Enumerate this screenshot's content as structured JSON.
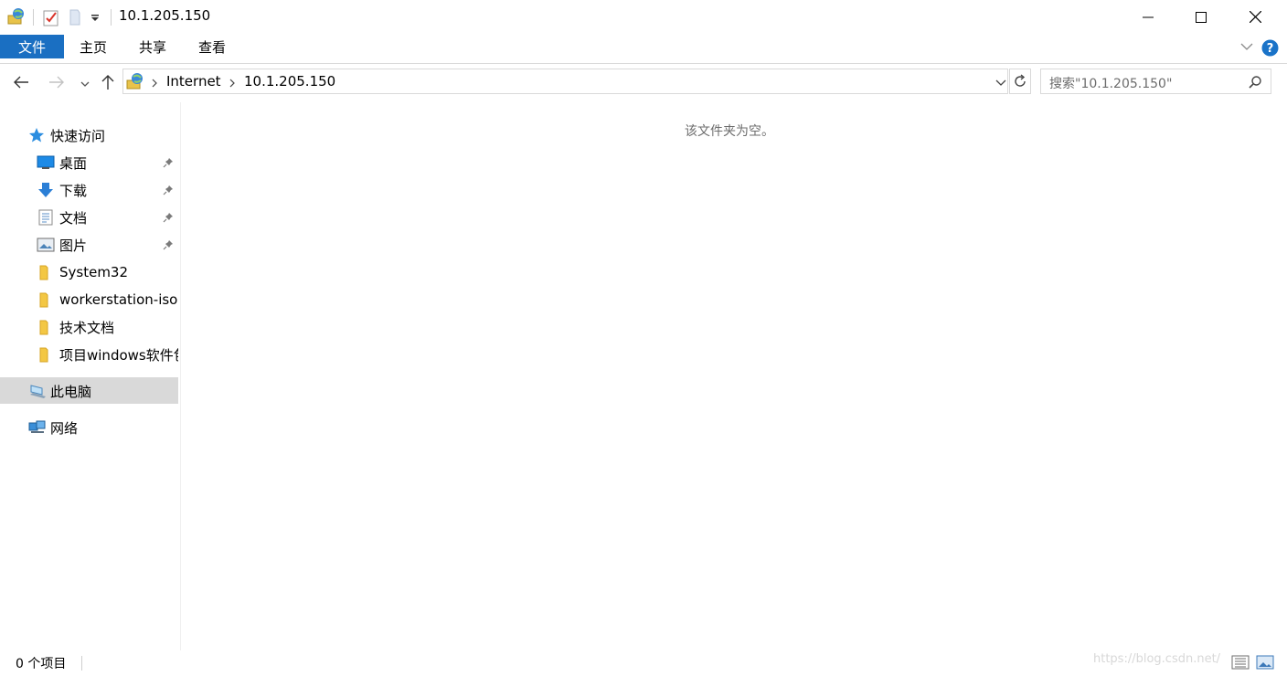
{
  "window": {
    "title": "10.1.205.150"
  },
  "ribbon": {
    "tabs": [
      "文件",
      "主页",
      "共享",
      "查看"
    ]
  },
  "address": {
    "crumbs": [
      "Internet",
      "10.1.205.150"
    ]
  },
  "search": {
    "placeholder": "搜索\"10.1.205.150\""
  },
  "nav": {
    "quick_access": "快速访问",
    "items": [
      {
        "label": "桌面",
        "icon": "desktop-icon",
        "pinned": true
      },
      {
        "label": "下载",
        "icon": "download-icon",
        "pinned": true
      },
      {
        "label": "文档",
        "icon": "document-icon",
        "pinned": true
      },
      {
        "label": "图片",
        "icon": "pictures-icon",
        "pinned": true
      },
      {
        "label": "System32",
        "icon": "folder-icon",
        "pinned": false
      },
      {
        "label": "workerstation-iso",
        "icon": "folder-icon",
        "pinned": false
      },
      {
        "label": "技术文档",
        "icon": "folder-icon",
        "pinned": false
      },
      {
        "label": "项目windows软件包",
        "icon": "folder-icon",
        "pinned": false
      }
    ],
    "this_pc": "此电脑",
    "network": "网络"
  },
  "content": {
    "empty_message": "该文件夹为空。"
  },
  "status": {
    "item_count": "0 个项目"
  },
  "watermark": "https://blog.csdn.net/",
  "colors": {
    "accent": "#1a6fc2",
    "selected": "#d9d9d9",
    "help": "#1a73c8"
  }
}
